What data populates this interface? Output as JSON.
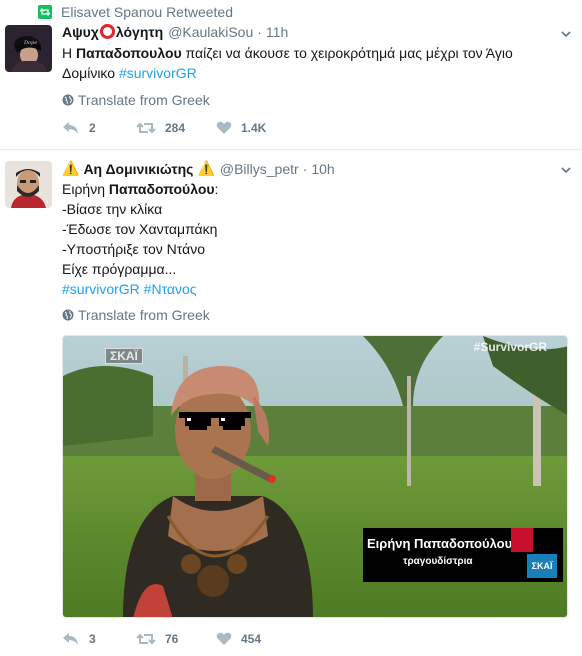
{
  "retweet_context": {
    "text": "Elisavet Spanou Retweeted",
    "icon": "retweet-icon",
    "color": "#17bf63"
  },
  "tweets": [
    {
      "name_prefix": "Αψυχ",
      "name_suffix": "λόγητη",
      "handle": "@KaulakiSou",
      "dot": "·",
      "time": "11h",
      "text_line1_a": "Η ",
      "text_line1_bold": "Παπαδοπουλου",
      "text_line1_b": " παίζει να άκουσε το χειροκρότημά μας μέχρι τον Άγιο",
      "text_line2": "Δομίνικο ",
      "hashtag": "#survivorGR",
      "translate": "Translate from Greek",
      "replies": "2",
      "retweets": "284",
      "likes": "1.4K"
    },
    {
      "name": "Αη Δομινικιώτης",
      "warning": "⚠️",
      "handle": "@Billys_petr",
      "dot": "·",
      "time": "10h",
      "line1_a": "Ειρήνη ",
      "line1_bold": "Παπαδοπούλου",
      "line1_b": ":",
      "line2": "-Βίασε την κλίκα",
      "line3": "-Έδωσε τον Χανταμπάκη",
      "line4": "-Υποστήριξε τον Ντάνο",
      "line5": "Είχε πρόγραμμα...",
      "hashtags": "#survivorGR #Ντανος",
      "translate": "Translate from Greek",
      "media": {
        "channel_logo": "ΣΚΑΪ",
        "tag": "#SurvivorGR",
        "caption_name": "Ειρήνη Παπαδοπούλου",
        "caption_role": "τραγουδίστρια",
        "corner_logo": "ΣΚΑΪ"
      },
      "replies": "3",
      "retweets": "76",
      "likes": "454"
    }
  ],
  "colors": {
    "link": "#1da1f2",
    "muted": "#657786",
    "text": "#14171a",
    "retweet_green": "#17bf63"
  }
}
